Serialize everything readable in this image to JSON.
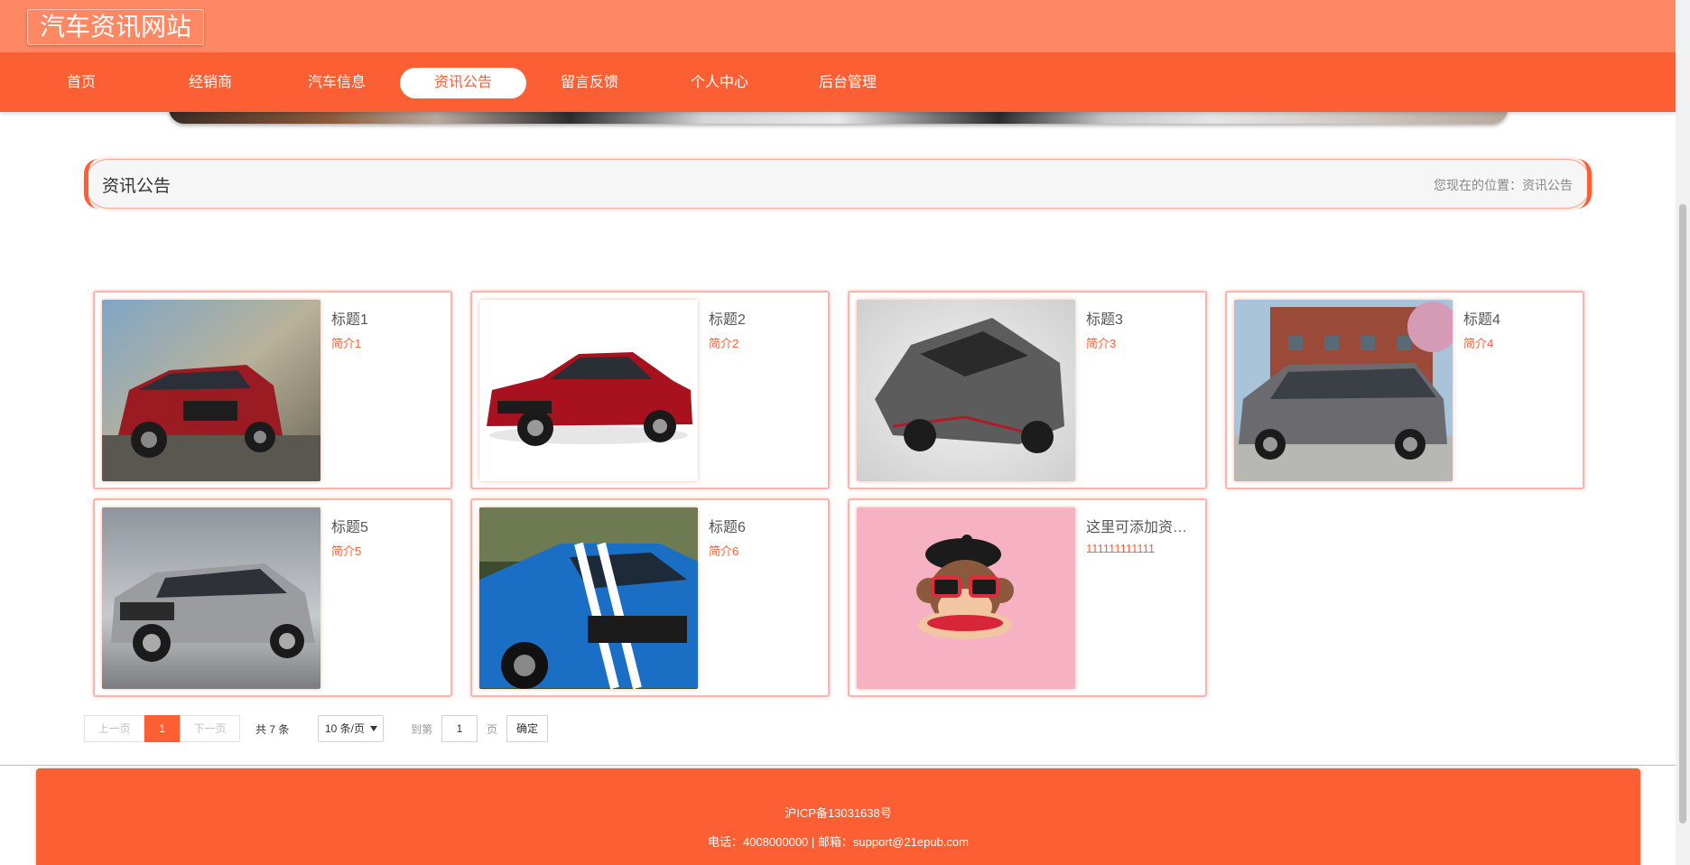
{
  "header": {
    "site_title": "汽车资讯网站"
  },
  "nav": {
    "items": [
      {
        "label": "首页"
      },
      {
        "label": "经销商"
      },
      {
        "label": "汽车信息"
      },
      {
        "label": "资讯公告",
        "active": true
      },
      {
        "label": "留言反馈"
      },
      {
        "label": "个人中心"
      },
      {
        "label": "后台管理"
      }
    ]
  },
  "section": {
    "title": "资讯公告",
    "breadcrumb": "您现在的位置：资讯公告"
  },
  "news": [
    {
      "title": "标题1",
      "desc": "简介1",
      "image": "red-suv-image"
    },
    {
      "title": "标题2",
      "desc": "简介2",
      "image": "red-sedan-image"
    },
    {
      "title": "标题3",
      "desc": "简介3",
      "image": "gray-supercar-image"
    },
    {
      "title": "标题4",
      "desc": "简介4",
      "image": "gray-minivan-image"
    },
    {
      "title": "标题5",
      "desc": "简介5",
      "image": "silver-suv-image"
    },
    {
      "title": "标题6",
      "desc": "简介6",
      "image": "blue-muscle-car-image"
    },
    {
      "title": "这里可添加资讯公告",
      "desc": "111111111111",
      "image": "monkey-avatar-image"
    }
  ],
  "pagination": {
    "prev": "上一页",
    "current": "1",
    "next": "下一页",
    "total": "共 7 条",
    "page_size": "10 条/页",
    "goto_prefix": "到第",
    "goto_value": "1",
    "goto_suffix": "页",
    "confirm": "确定"
  },
  "footer": {
    "icp": "沪ICP备13031638号",
    "contact": "电话：4008000000 | 邮箱：support@21epub.com"
  },
  "colors": {
    "primary": "#fb5f33",
    "header_bg": "#fd8863",
    "card_border": "#fcb3ad"
  }
}
